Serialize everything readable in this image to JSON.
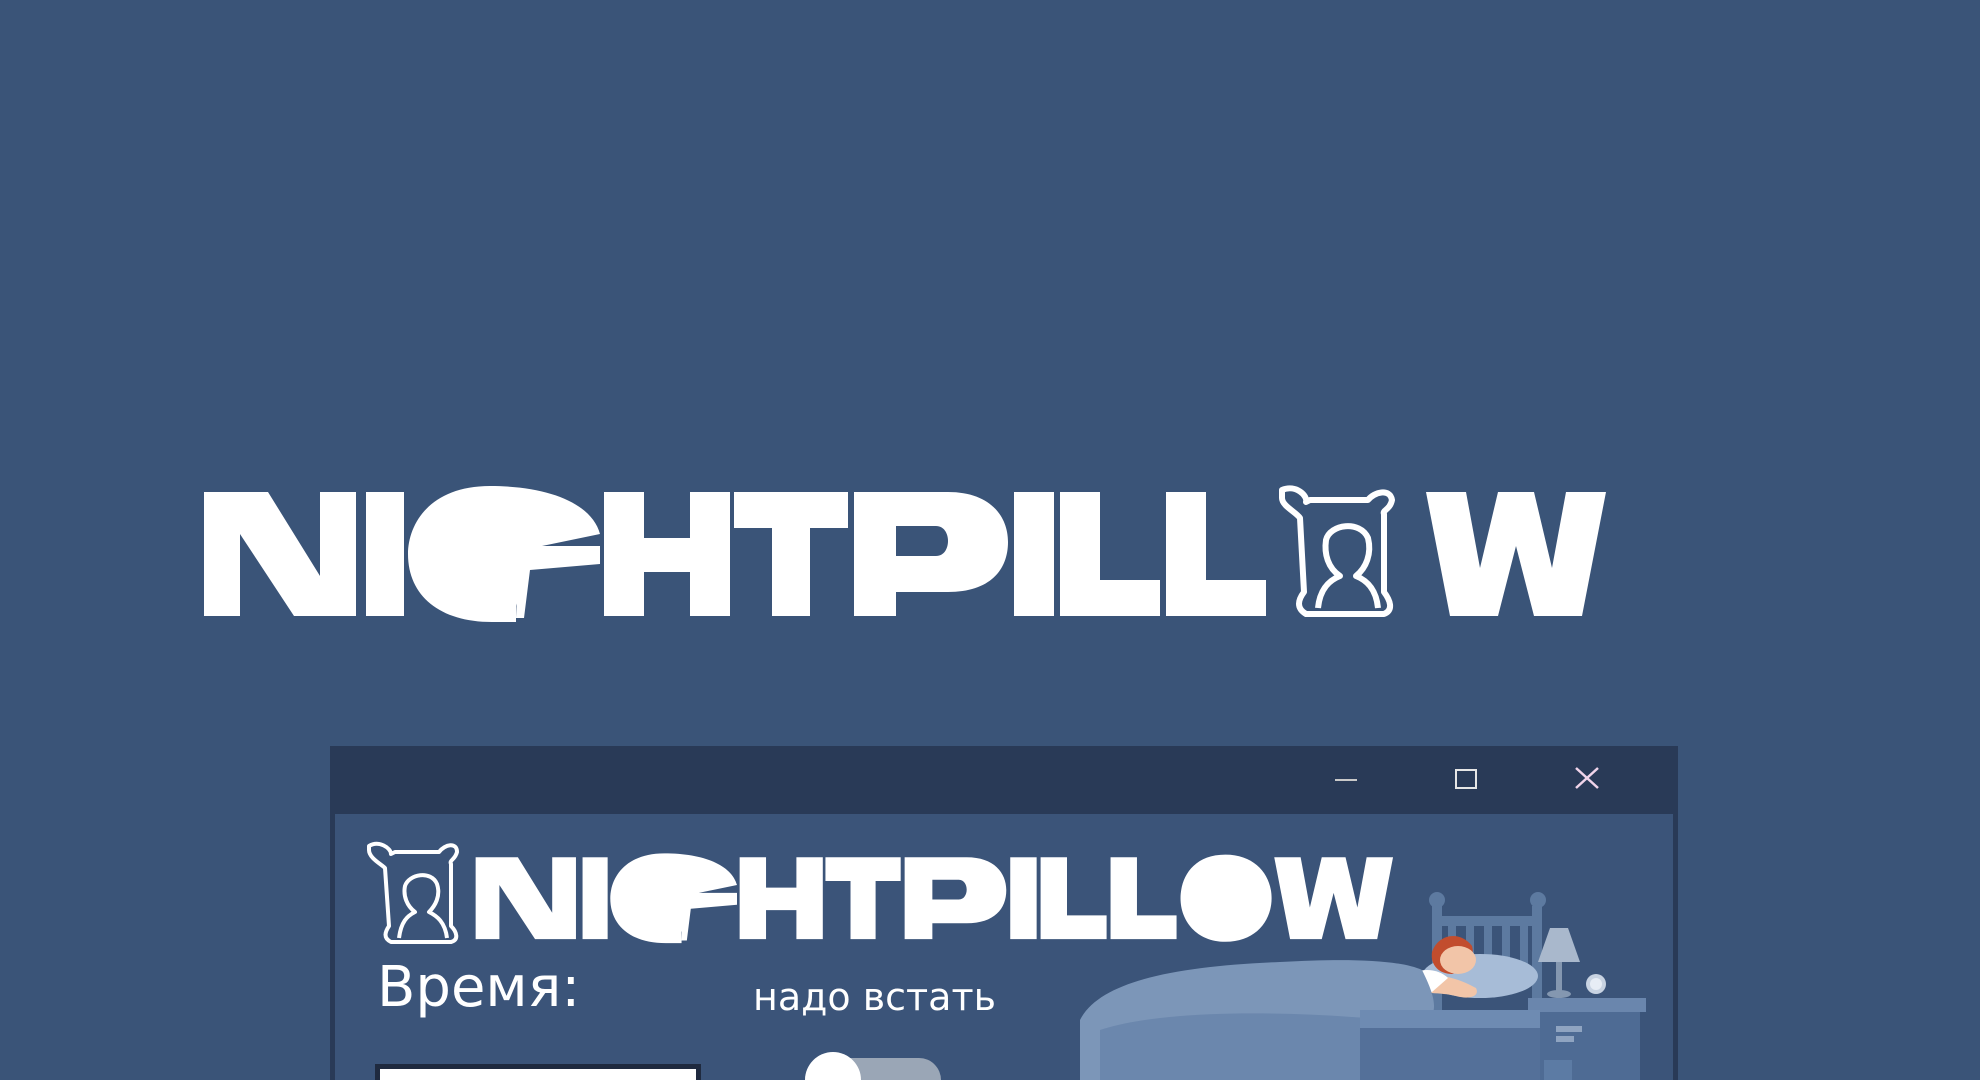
{
  "hero": {
    "logo_text": "NIGHTPILLOW"
  },
  "window": {
    "controls": {
      "minimize_icon": "minimize-icon",
      "maximize_icon": "maximize-icon",
      "close_icon": "close-icon"
    }
  },
  "app": {
    "logo_text": "NIGHTPILLOW",
    "time_label": "Время:",
    "status_text": "надо встать",
    "time_input_value": "",
    "alarm_toggle_on": false
  },
  "colors": {
    "background": "#3a5478",
    "titlebar": "#293a57",
    "content": "#3b5479",
    "text": "#ffffff",
    "close_hover": "#e3c4dc"
  }
}
